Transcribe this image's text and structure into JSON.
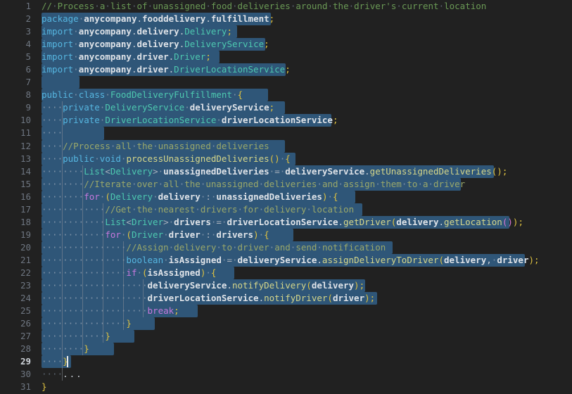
{
  "app": {
    "kind": "code-editor",
    "language": "Java",
    "theme": "dark",
    "background": "#212121",
    "selection_color": "#2f5678",
    "gutter_color": "#6e7681",
    "active_line": 29,
    "cursor_line": 29,
    "total_lines": 31
  },
  "colors": {
    "comment_top": "#6a9955",
    "comment_inline": "#9aa86a",
    "keyword": "#56b6e0",
    "control_keyword": "#c678dd",
    "type": "#4ec9b0",
    "identifier": "#dfe3e8",
    "method": "#d6d78a",
    "semicolon": "#e0c341",
    "bracket_yellow": "#e0c341",
    "bracket_magenta": "#d774d2",
    "bracket_blue": "#41a6f6",
    "whitespace_dot": "#5e6672",
    "indent_guide": "#8a8f98",
    "cursor": "#e8eaed"
  },
  "gutter": {
    "numbers": [
      1,
      2,
      3,
      4,
      5,
      6,
      7,
      8,
      9,
      10,
      11,
      12,
      13,
      14,
      15,
      16,
      17,
      18,
      19,
      20,
      21,
      22,
      23,
      24,
      25,
      26,
      27,
      28,
      29,
      30,
      31
    ]
  },
  "code": {
    "lines": [
      {
        "n": 1,
        "text": "// Process a list of unassigned food deliveries around the driver's current location",
        "selected": false
      },
      {
        "n": 2,
        "text": "package anycompany.fooddelivery.fulfillment;",
        "selected": true
      },
      {
        "n": 3,
        "text": "import anycompany.delivery.Delivery;",
        "selected": true
      },
      {
        "n": 4,
        "text": "import anycompany.delivery.DeliveryService;",
        "selected": true
      },
      {
        "n": 5,
        "text": "import anycompany.driver.Driver;",
        "selected": true
      },
      {
        "n": 6,
        "text": "import anycompany.driver.DriverLocationService;",
        "selected": true
      },
      {
        "n": 7,
        "text": "",
        "selected": true
      },
      {
        "n": 8,
        "text": "public class FoodDeliveryFulfillment {",
        "selected": true
      },
      {
        "n": 9,
        "text": "    private DeliveryService deliveryService;",
        "selected": true
      },
      {
        "n": 10,
        "text": "    private DriverLocationService driverLocationService;",
        "selected": true
      },
      {
        "n": 11,
        "text": "    ",
        "selected": true
      },
      {
        "n": 12,
        "text": "    //Process all the unassigned deliveries",
        "selected": true
      },
      {
        "n": 13,
        "text": "    public void processUnassignedDeliveries() {",
        "selected": true
      },
      {
        "n": 14,
        "text": "        List<Delivery> unassignedDeliveries = deliveryService.getUnassignedDeliveries();",
        "selected": true
      },
      {
        "n": 15,
        "text": "        //Iterate over all the unassigned deliveries and assign them to a driver",
        "selected": true
      },
      {
        "n": 16,
        "text": "        for (Delivery delivery : unassignedDeliveries) {",
        "selected": true
      },
      {
        "n": 17,
        "text": "            //Get the nearest drivers for delivery location",
        "selected": true
      },
      {
        "n": 18,
        "text": "            List<Driver> drivers = driverLocationService.getDriver(delivery.getLocation());",
        "selected": true
      },
      {
        "n": 19,
        "text": "            for (Driver driver : drivers) {",
        "selected": true
      },
      {
        "n": 20,
        "text": "                //Assign delivery to driver and send notification",
        "selected": true
      },
      {
        "n": 21,
        "text": "                boolean isAssigned = deliveryService.assignDeliveryToDriver(delivery, driver);",
        "selected": true
      },
      {
        "n": 22,
        "text": "                if (isAssigned) {",
        "selected": true
      },
      {
        "n": 23,
        "text": "                    deliveryService.notifyDelivery(delivery);",
        "selected": true
      },
      {
        "n": 24,
        "text": "                    driverLocationService.notifyDriver(driver);",
        "selected": true
      },
      {
        "n": 25,
        "text": "                    break;",
        "selected": true
      },
      {
        "n": 26,
        "text": "                }",
        "selected": true
      },
      {
        "n": 27,
        "text": "            }",
        "selected": true
      },
      {
        "n": 28,
        "text": "        }",
        "selected": true
      },
      {
        "n": 29,
        "text": "    }",
        "selected": true
      },
      {
        "n": 30,
        "text": "    ...",
        "selected": false
      },
      {
        "n": 31,
        "text": "}",
        "selected": false
      }
    ]
  }
}
